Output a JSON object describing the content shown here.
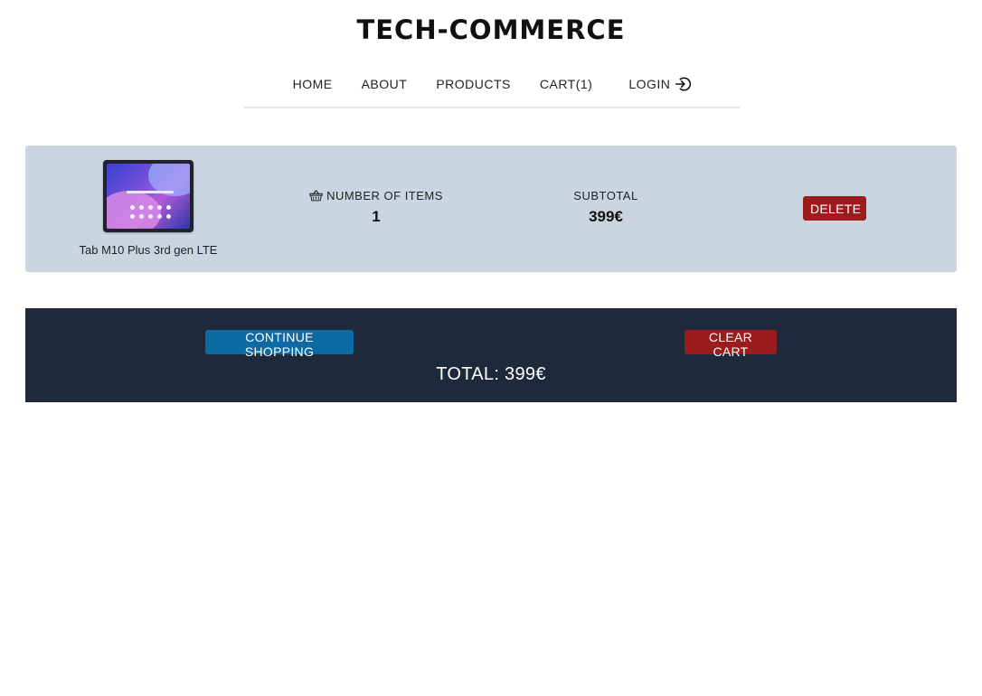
{
  "header": {
    "title": "TECH-COMMERCE"
  },
  "nav": {
    "home": "HOME",
    "about": "ABOUT",
    "products": "PRODUCTS",
    "cart": "CART(1)",
    "login": "LOGIN",
    "login_icon": "login-arrow-icon"
  },
  "cart": {
    "items": [
      {
        "name": "Tab M10 Plus 3rd gen LTE",
        "image": "tablet-product-image",
        "quantity_label": "NUMBER OF ITEMS",
        "quantity_icon": "basket-icon",
        "quantity": "1",
        "subtotal_label": "SUBTOTAL",
        "subtotal": "399€",
        "delete_label": "DELETE"
      }
    ]
  },
  "footer": {
    "continue_label": "CONTINUE SHOPPING",
    "clear_label": "CLEAR CART",
    "total": "TOTAL: 399€"
  },
  "colors": {
    "row_background": "#cbd5e1",
    "footer_background": "#1e293b",
    "danger": "#9b1c1c",
    "primary": "#0e6aa3"
  }
}
